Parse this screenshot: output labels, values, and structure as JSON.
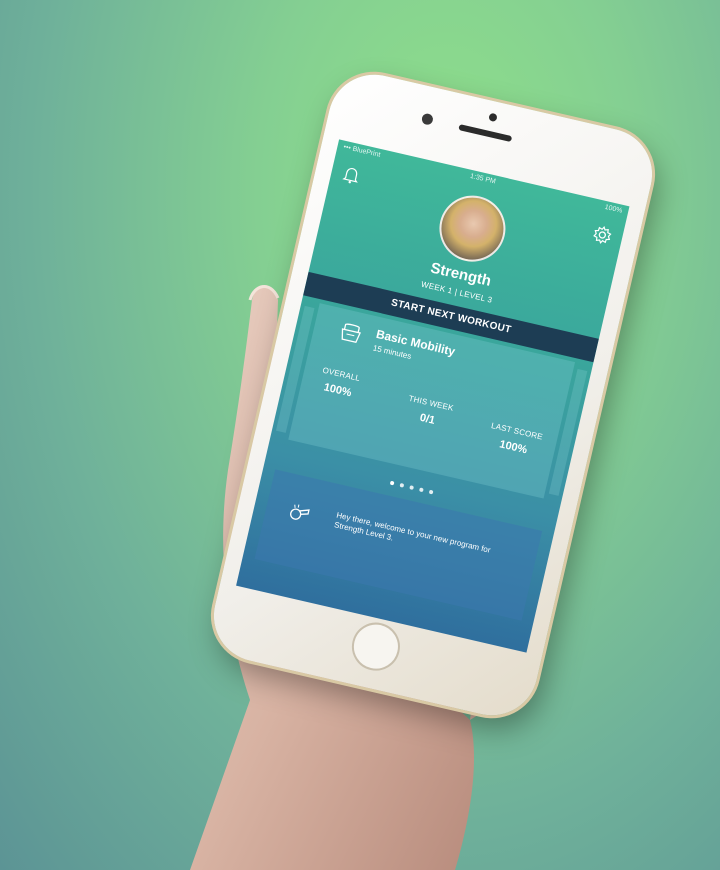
{
  "status_bar": {
    "carrier": "••• BluePrint",
    "time": "1:35 PM",
    "battery": "100%"
  },
  "header": {
    "icons": [
      "bell-icon",
      "gear-icon"
    ],
    "program_title": "Strength",
    "program_subtitle": "WEEK 1 | LEVEL 3"
  },
  "workout": {
    "start_label": "START NEXT WORKOUT",
    "name": "Basic Mobility",
    "duration": "15 minutes",
    "icon": "kettlebell-icon",
    "stats": [
      {
        "label": "OVERALL",
        "value": "100%"
      },
      {
        "label": "THIS WEEK",
        "value": "0/1"
      },
      {
        "label": "LAST SCORE",
        "value": "100%"
      }
    ],
    "pager": {
      "count": 5,
      "active": 1
    }
  },
  "message": {
    "icon": "whistle-icon",
    "text": "Hey there, welcome to your new program for Strength Level 3."
  },
  "colors": {
    "background": "#84cf92",
    "screen_top": "#40b89a",
    "screen_bottom": "#2f6f9e",
    "start_button": "#1d3d54"
  }
}
